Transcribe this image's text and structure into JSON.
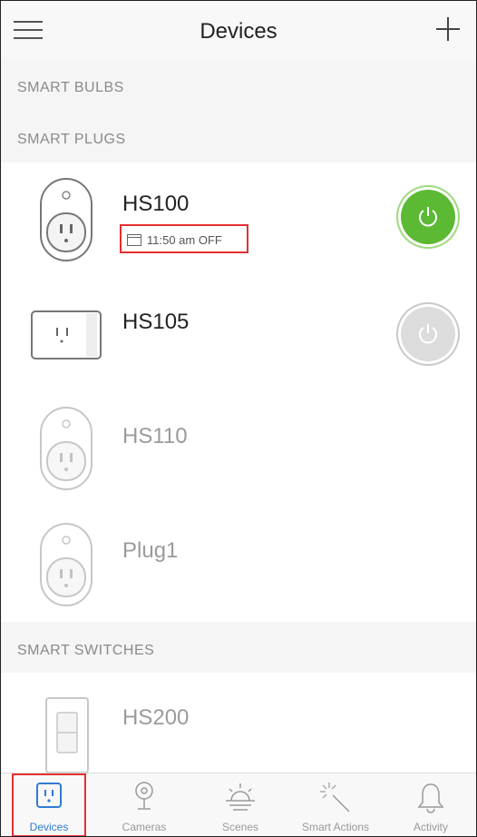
{
  "header": {
    "title": "Devices"
  },
  "sections": {
    "smart_bulbs": "SMART BULBS",
    "smart_plugs": "SMART PLUGS",
    "smart_switches": "SMART SWITCHES"
  },
  "devices": {
    "hs100": {
      "name": "HS100",
      "schedule": "11:50 am OFF",
      "power": "on"
    },
    "hs105": {
      "name": "HS105",
      "power": "off"
    },
    "hs110": {
      "name": "HS110"
    },
    "plug1": {
      "name": "Plug1"
    },
    "hs200": {
      "name": "HS200"
    }
  },
  "tabs": [
    {
      "label": "Devices",
      "active": true
    },
    {
      "label": "Cameras"
    },
    {
      "label": "Scenes"
    },
    {
      "label": "Smart Actions"
    },
    {
      "label": "Activity"
    }
  ],
  "colors": {
    "power_on": "#5cb933",
    "accent": "#2f7bd4",
    "highlight": "#e53030"
  }
}
